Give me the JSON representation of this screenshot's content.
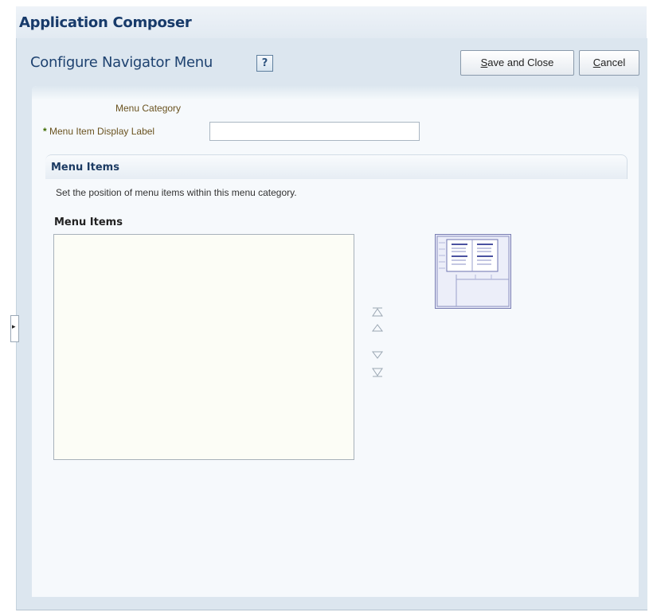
{
  "app": {
    "title": "Application Composer"
  },
  "page": {
    "title": "Configure Navigator Menu",
    "help": "?"
  },
  "toolbar": {
    "save_close_prefix": "S",
    "save_close_rest": "ave and Close",
    "cancel_prefix": "C",
    "cancel_rest": "ancel"
  },
  "form": {
    "menu_category_label": "Menu Category",
    "required_mark": "*",
    "display_label": "Menu Item Display Label",
    "display_value": ""
  },
  "section": {
    "title": "Menu Items",
    "description": "Set the position of menu items within this menu category.",
    "list_label": "Menu Items",
    "items": []
  },
  "reorder": {
    "top_icon": "▲",
    "up_icon": "△",
    "down_icon": "▽",
    "bottom_icon": "▼"
  },
  "icons": {
    "help": "help-icon",
    "panel_toggle": "expand-panel-icon",
    "layout_thumbnail": "menu-layout-thumbnail"
  },
  "colors": {
    "title": "#173a6a",
    "label": "#6a5320",
    "required": "#3d6b00",
    "panel": "#dce6ef"
  }
}
